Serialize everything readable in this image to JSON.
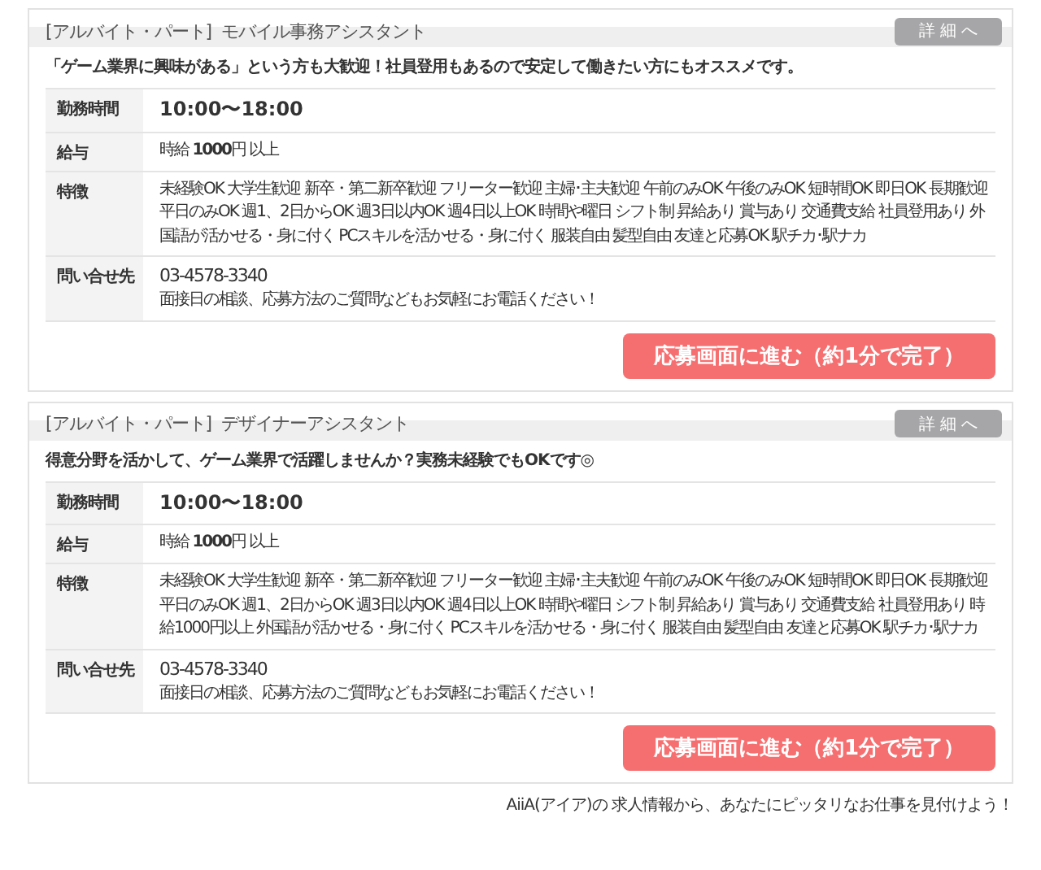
{
  "jobs": [
    {
      "category": "[アルバイト・パート]",
      "title": "モバイル事務アシスタント",
      "detail_button": "詳 細 へ",
      "catch": "「ゲーム業界に興味がある」という方も大歓迎！社員登用もあるので安定して働きたい方にもオススメです。",
      "rows": [
        {
          "kind": "time",
          "label": "勤務時間",
          "value": "10:00〜18:00"
        },
        {
          "kind": "salary",
          "label": "給与",
          "value": "時給 **1000**円 以上"
        },
        {
          "kind": "text",
          "label": "特徴",
          "lines": [
            "未経験OK 大学生歓迎 新卒・第二新卒歓迎 フリーター歓迎 主婦･主夫歓迎 午前のみOK 午後のみOK 短時間OK 即日OK 長期歓迎",
            "平日のみOK 週1、2日からOK 週3日以内OK 週4日以上OK 時間や曜日 シフト制 昇給あり 賞与あり 交通費支給 社員登用あり 外",
            "国語が活かせる・身に付く PCスキルを活かせる・身に付く 服装自由 髪型自由 友達と応募OK 駅チカ･駅ナカ"
          ]
        },
        {
          "kind": "contact",
          "label": "問い合せ先",
          "value": "03-4578-3340",
          "note": "面接日の相談、応募方法のご質問などもお気軽にお電話ください！"
        }
      ],
      "apply_button": "応募画面に進む（約1分で完了）"
    },
    {
      "category": "[アルバイト・パート]",
      "title": "デザイナーアシスタント",
      "detail_button": "詳 細 へ",
      "catch": "得意分野を活かして、ゲーム業界で活躍しませんか？実務未経験でもOKです◎",
      "rows": [
        {
          "kind": "time",
          "label": "勤務時間",
          "value": "10:00〜18:00"
        },
        {
          "kind": "salary",
          "label": "給与",
          "value": "時給 **1000**円 以上"
        },
        {
          "kind": "text",
          "label": "特徴",
          "lines": [
            "未経験OK 大学生歓迎 新卒・第二新卒歓迎 フリーター歓迎 主婦･主夫歓迎 午前のみOK 午後のみOK 短時間OK 即日OK 長期歓迎",
            "平日のみOK 週1、2日からOK 週3日以内OK 週4日以上OK 時間や曜日 シフト制 昇給あり 賞与あり 交通費支給 社員登用あり 時",
            "給1000円以上 外国語が活かせる・身に付く PCスキルを活かせる・身に付く 服装自由 髪型自由 友達と応募OK 駅チカ･駅ナカ"
          ]
        },
        {
          "kind": "contact",
          "label": "問い合せ先",
          "value": "03-4578-3340",
          "note": "面接日の相談、応募方法のご質問などもお気軽にお電話ください！"
        }
      ],
      "apply_button": "応募画面に進む（約1分で完了）"
    }
  ],
  "footer": "AiiA(アイア)の 求人情報から、あなたにピッタリなお仕事を見付けよう！"
}
